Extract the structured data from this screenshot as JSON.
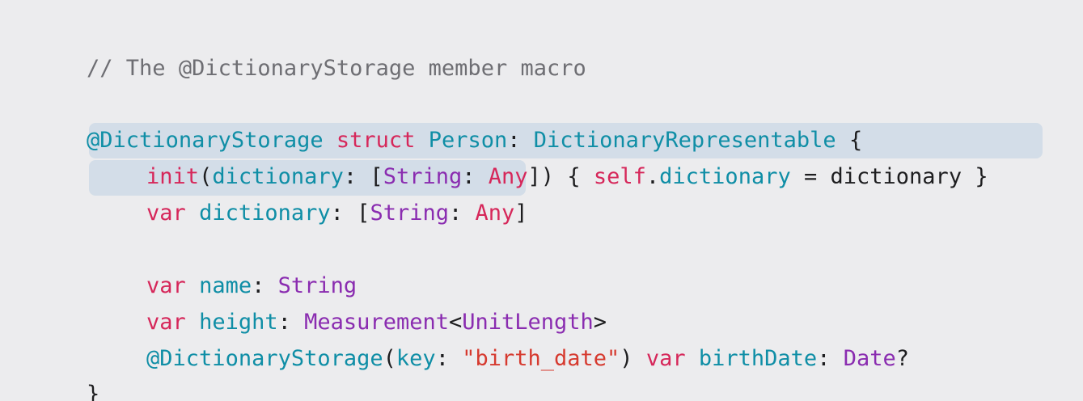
{
  "colors": {
    "background": "#ececee",
    "highlight": "#d3dde8",
    "comment": "#6e6e73",
    "keyword": "#d6275a",
    "identifier": "#0f8ea6",
    "stdtype": "#8a2cb0",
    "string": "#d63a2f",
    "plain": "#1d1d1f"
  },
  "code": {
    "comment": "// The @DictionaryStorage member macro",
    "line_struct": {
      "attr": "@DictionaryStorage",
      "kw_struct": "struct",
      "type_name": "Person",
      "colon": ":",
      "protocol": "DictionaryRepresentable",
      "brace": "{"
    },
    "line_init": {
      "kw_init": "init",
      "open_paren": "(",
      "param": "dictionary",
      "colon": ":",
      "bracket_open": "[",
      "type_string": "String",
      "colon2": ":",
      "type_any": "Any",
      "close": "])",
      "brace_open": "{",
      "kw_self": "self",
      "dot": ".",
      "prop": "dictionary",
      "equals": "=",
      "value": "dictionary",
      "brace_close": "}"
    },
    "line_var_dict": {
      "kw_var": "var",
      "name": "dictionary",
      "colon": ":",
      "bracket_open": "[",
      "type_string": "String",
      "colon2": ":",
      "type_any": "Any",
      "bracket_close": "]"
    },
    "line_var_name": {
      "kw_var": "var",
      "name": "name",
      "colon": ":",
      "type": "String"
    },
    "line_var_height": {
      "kw_var": "var",
      "name": "height",
      "colon": ":",
      "type": "Measurement",
      "lt": "<",
      "generic": "UnitLength",
      "gt": ">"
    },
    "line_birth": {
      "attr": "@DictionaryStorage",
      "open_paren": "(",
      "label": "key",
      "colon": ":",
      "string": "\"birth_date\"",
      "close_paren": ")",
      "kw_var": "var",
      "name": "birthDate",
      "colon2": ":",
      "type": "Date",
      "optional": "?"
    },
    "closing_brace": "}"
  }
}
